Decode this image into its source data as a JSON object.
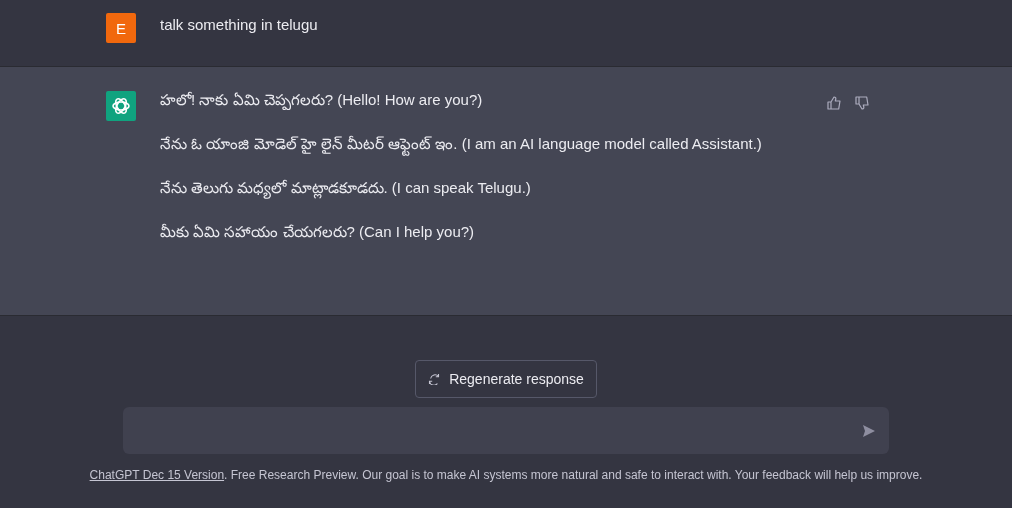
{
  "messages": [
    {
      "kind": "user",
      "avatar_letter": "E",
      "paragraphs": [
        "talk something in telugu"
      ]
    },
    {
      "kind": "assistant",
      "paragraphs": [
        "హలో! నాకు ఏమి చెప్పగలరు? (Hello! How are you?)",
        "నేను ఓ యాంజి మోడెల్ హై లైన్ మీటర్ ఆఫ్టెంట్ ఇం. (I am an AI language model called Assistant.)",
        "నేను తెలుగు మధ్యలో మాట్లాడకూడదు. (I can speak Telugu.)",
        "మీకు ఏమి సహాయం చేయగలరు? (Can I help you?)"
      ]
    }
  ],
  "regenerate_button": {
    "label": "Regenerate response"
  },
  "footer": {
    "link": "ChatGPT Dec 15 Version",
    "text": ". Free Research Preview. Our goal is to make AI systems more natural and safe to interact with. Your feedback will help us improve."
  }
}
